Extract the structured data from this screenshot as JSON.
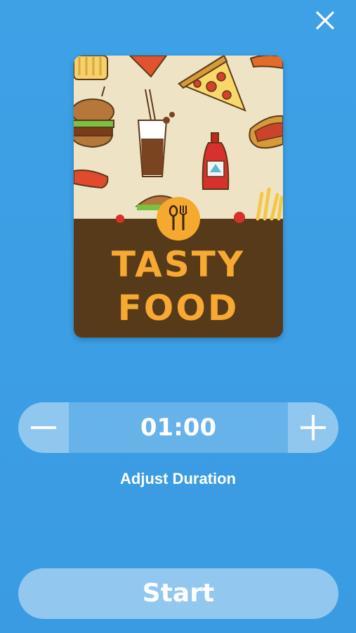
{
  "top_bar": {
    "close_icon": "close-icon"
  },
  "card": {
    "title_line_1": "TASTY",
    "title_line_2": "FOOD",
    "badge_icon": "spoon-fork-icon",
    "colors": {
      "top": "#efe3c6",
      "bottom": "#573a1a",
      "accent": "#f7aa31"
    }
  },
  "duration": {
    "value": "01:00",
    "label": "Adjust Duration",
    "decrease_icon": "minus-icon",
    "increase_icon": "plus-icon"
  },
  "actions": {
    "start_label": "Start"
  },
  "theme": {
    "background": "#3ea1e6"
  }
}
